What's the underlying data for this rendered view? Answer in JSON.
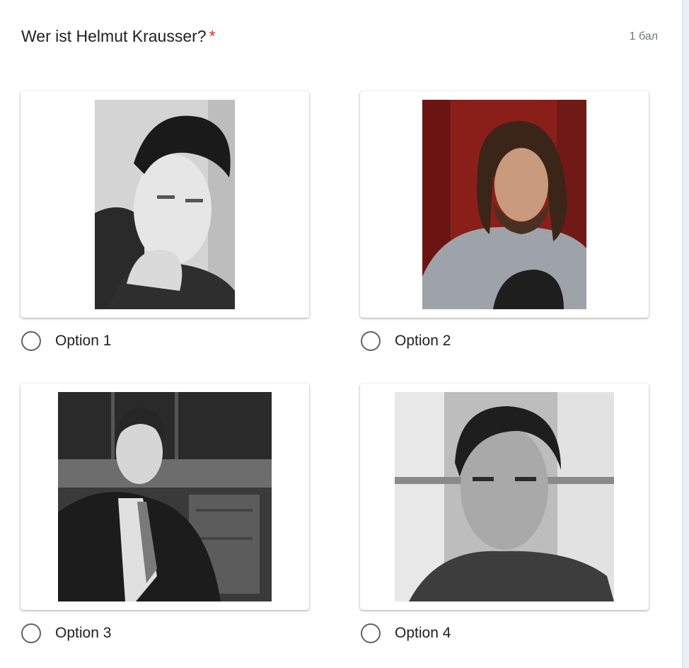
{
  "question": {
    "title": "Wer ist Helmut Krausser?",
    "required_marker": "*",
    "points": "1 бал"
  },
  "options": [
    {
      "label": "Option 1"
    },
    {
      "label": "Option 2"
    },
    {
      "label": "Option 3"
    },
    {
      "label": "Option 4"
    }
  ],
  "colors": {
    "required": "#d93025",
    "radio_border": "#5f6368",
    "text": "#202124",
    "muted": "#70757a"
  }
}
